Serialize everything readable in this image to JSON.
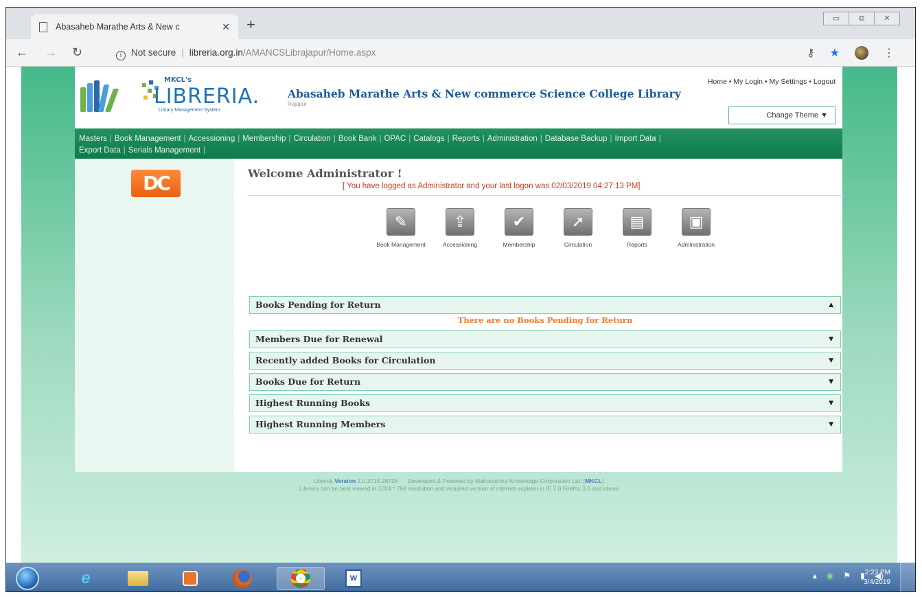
{
  "browser": {
    "tab_title": "Abasaheb Marathe Arts & New c",
    "tab_close": "✕",
    "new_tab": "+",
    "security": "Not secure",
    "url_host": "libreria.org.in",
    "url_path": "/AMANCSLibrajapur/Home.aspx"
  },
  "header": {
    "logo_mkcl": "MKCL's",
    "logo_name": "LIBRERIA.",
    "logo_tagline": "Library Management System",
    "college_name": "Abasaheb Marathe Arts & New commerce Science College Library",
    "college_place": "Rajapur",
    "links": [
      "Home",
      "My Login",
      "My Settings",
      "Logout"
    ],
    "link_separator": " • ",
    "change_theme": "Change Theme ▼"
  },
  "menu": [
    "Masters",
    "Book Management",
    "Accessioning",
    "Membership",
    "Circulation",
    "Book Bank",
    "OPAC",
    "Catalogs",
    "Reports",
    "Administration",
    "Database Backup",
    "Import Data",
    "Export Data",
    "Serials Management"
  ],
  "left": {
    "logo_text": "DC"
  },
  "main": {
    "welcome": "Welcome Administrator !",
    "last_logon": "[ You have logged as Administrator and your last logon was 02/03/2019 04:27:13 PM]",
    "quick_icons": [
      {
        "label": "Book Management",
        "icon": "book-icon"
      },
      {
        "label": "Accessioning",
        "icon": "accession-icon"
      },
      {
        "label": "Membership",
        "icon": "membership-icon"
      },
      {
        "label": "Circulation",
        "icon": "circulation-icon"
      },
      {
        "label": "Reports",
        "icon": "reports-icon"
      },
      {
        "label": "Administration",
        "icon": "administration-icon"
      }
    ],
    "sections": [
      {
        "title": "Books Pending for Return",
        "arrow": "▲"
      },
      {
        "title": "Members Due for Renewal",
        "arrow": "▼"
      },
      {
        "title": "Recently added Books for Circulation",
        "arrow": "▼"
      },
      {
        "title": "Books Due for Return",
        "arrow": "▼"
      },
      {
        "title": "Highest Running Books",
        "arrow": "▼"
      },
      {
        "title": "Highest Running Members",
        "arrow": "▼"
      }
    ],
    "no_pending": "There are no Books Pending for Return"
  },
  "footer": {
    "version_prefix": "Libreria",
    "version_label": "Version",
    "version_number": "2.0.3715.28728",
    "developed": "Developed & Powered by Maharashtra Knowledge Corporation Ltd. [",
    "mkcl": "MKCL",
    "developed_end": "].",
    "note": "Libreria can be best viewed in 1024 * 768 resolution and required version of internet explorer is IE 7.0,Firefox 3.0 and above"
  },
  "taskbar": {
    "time": "2:23 PM",
    "date": "3/4/2019"
  }
}
